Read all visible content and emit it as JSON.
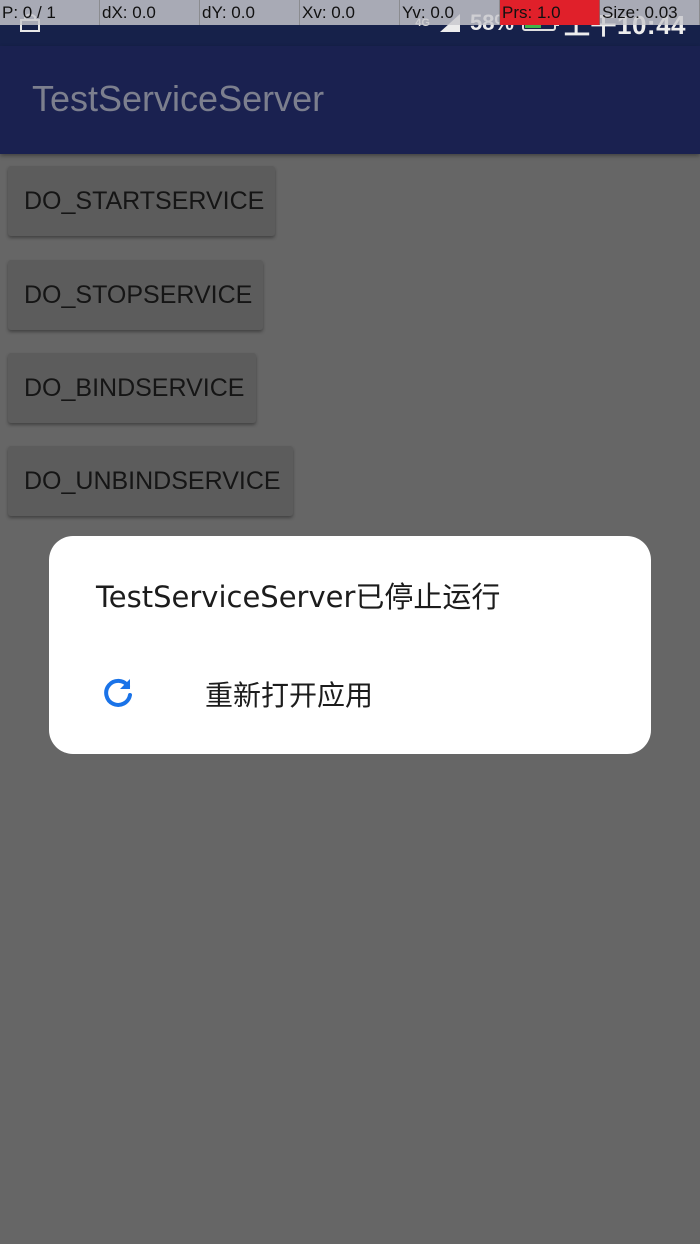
{
  "status_bar": {
    "network": "4G",
    "battery": "58%",
    "battery_level": 0.58,
    "time": "上午10:44"
  },
  "pointer_overlay": {
    "items": [
      "P: 0 / 1",
      "dX: 0.0",
      "dY: 0.0",
      "Xv: 0.0",
      "Yv: 0.0",
      "Prs: 1.0",
      "Size: 0.03"
    ]
  },
  "app_bar": {
    "title": "TestServiceServer"
  },
  "buttons": {
    "start": "DO_STARTSERVICE",
    "stop": "DO_STOPSERVICE",
    "bind": "DO_BINDSERVICE",
    "unbind": "DO_UNBINDSERVICE"
  },
  "dialog": {
    "title": "TestServiceServer已停止运行",
    "action_label": "重新打开应用",
    "action_icon": "refresh-icon"
  },
  "colors": {
    "dim_background": "#666666",
    "dialog_background": "#ffffff",
    "icon_blue": "#1a73e8",
    "overlay_alert": "#e0202a"
  }
}
